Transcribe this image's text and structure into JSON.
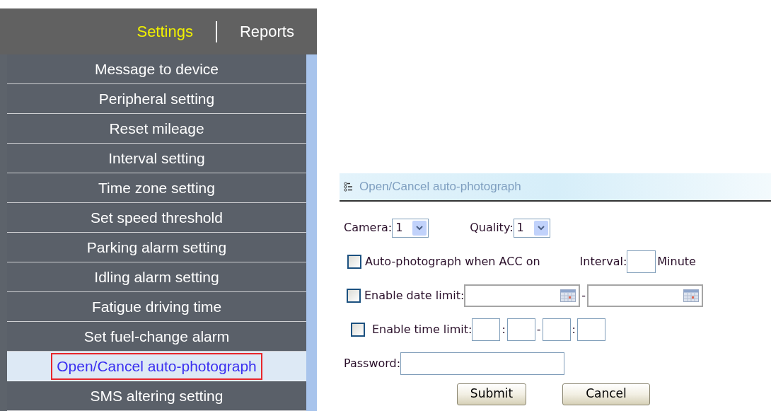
{
  "top_nav": [
    {
      "label": "Settings",
      "selected": true
    },
    {
      "label": "Reports",
      "selected": false
    }
  ],
  "menu": [
    {
      "label": "Message to device",
      "selected": false
    },
    {
      "label": "Peripheral setting",
      "selected": false
    },
    {
      "label": "Reset mileage",
      "selected": false
    },
    {
      "label": "Interval setting",
      "selected": false
    },
    {
      "label": "Time zone setting",
      "selected": false
    },
    {
      "label": "Set speed threshold",
      "selected": false
    },
    {
      "label": "Parking alarm setting",
      "selected": false
    },
    {
      "label": "Idling alarm setting",
      "selected": false
    },
    {
      "label": "Fatigue driving time",
      "selected": false
    },
    {
      "label": "Set fuel-change alarm",
      "selected": false
    },
    {
      "label": "Open/Cancel auto-photograph",
      "selected": true
    },
    {
      "label": "SMS altering setting",
      "selected": false
    }
  ],
  "dialog": {
    "title": "Open/Cancel auto-photograph",
    "camera": {
      "label": "Camera:",
      "value": "1"
    },
    "quality": {
      "label": "Quality:",
      "value": "1"
    },
    "acc": {
      "label": "Auto-photograph when ACC on",
      "checked": false
    },
    "interval": {
      "label": "Interval:",
      "unit": "Minute"
    },
    "date_limit": {
      "label": "Enable date limit:",
      "checked": false,
      "separator": "-"
    },
    "time_limit": {
      "label": "Enable time limit:",
      "checked": false,
      "separators": [
        ":",
        "-",
        ":"
      ]
    },
    "password": {
      "label": "Password:"
    },
    "buttons": [
      "Submit",
      "Cancel"
    ]
  }
}
